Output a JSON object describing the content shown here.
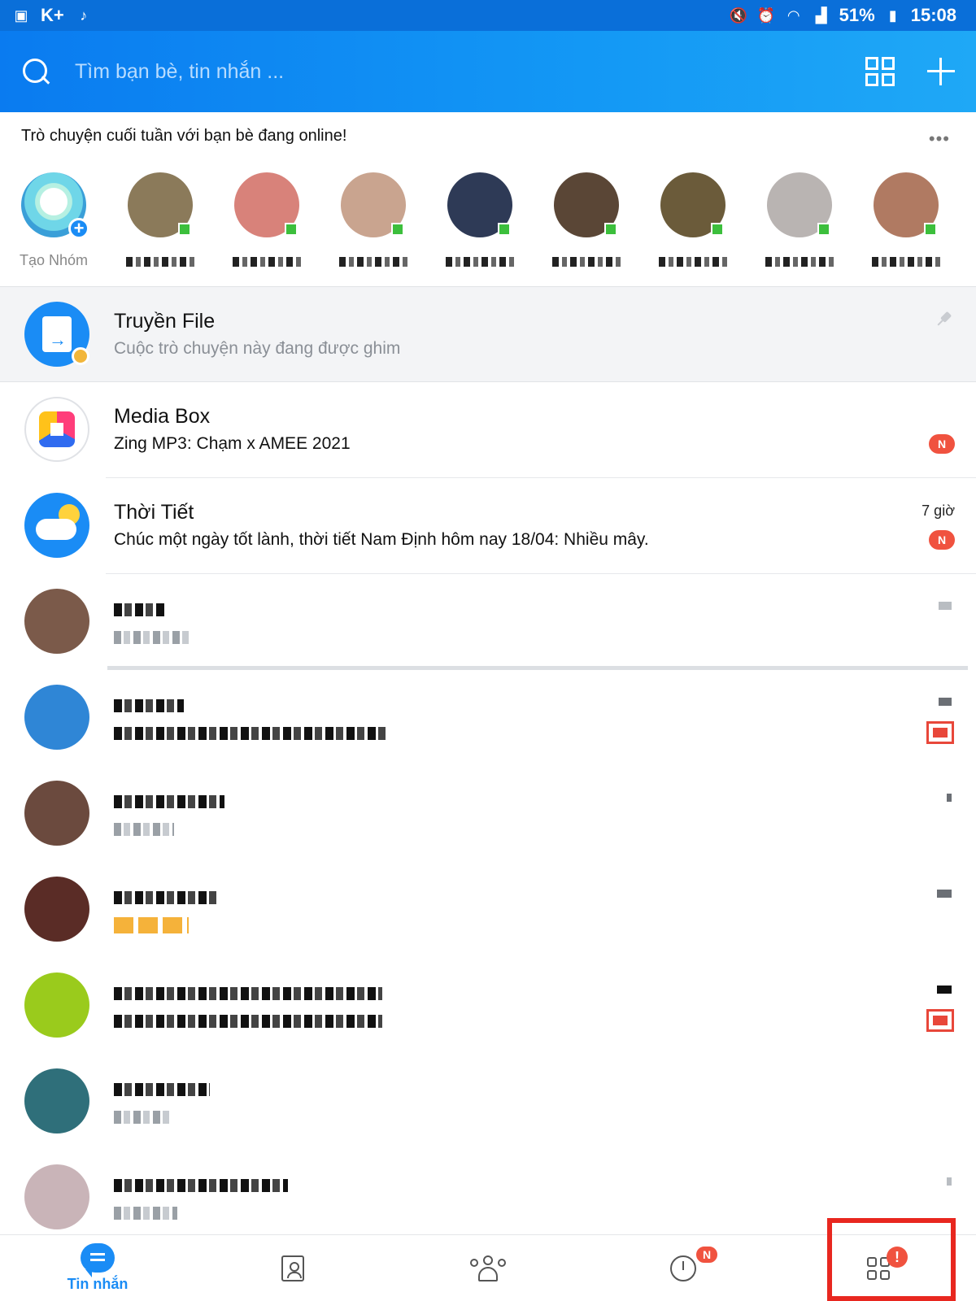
{
  "status_bar": {
    "icons_left": [
      "image-icon",
      "kplus-icon",
      "tiktok-icon"
    ],
    "kplus_label": "K+",
    "battery": "51%",
    "time": "15:08"
  },
  "header": {
    "search_placeholder": "Tìm bạn bè, tin nhắn ..."
  },
  "online": {
    "title": "Trò chuyện cuối tuần với bạn bè đang online!",
    "create_group_label": "Tạo Nhóm",
    "friends": [
      {
        "color": "#8b7a5a"
      },
      {
        "color": "#d8827a"
      },
      {
        "color": "#c9a48f"
      },
      {
        "color": "#2e3a56"
      },
      {
        "color": "#5a4636"
      },
      {
        "color": "#6b5b3a"
      },
      {
        "color": "#b9b4b2"
      },
      {
        "color": "#b07a62"
      }
    ]
  },
  "conversations": {
    "pinned": {
      "name": "Truyền File",
      "message": "Cuộc trò chuyện này đang được ghim"
    },
    "media_box": {
      "name": "Media Box",
      "message": "Zing MP3: Chạm x AMEE 2021",
      "badge": "N"
    },
    "weather": {
      "name": "Thời Tiết",
      "message": "Chúc một ngày tốt lành, thời tiết Nam Định hôm nay 18/04: Nhiều mây.",
      "time": "7 giờ",
      "badge": "N"
    }
  },
  "bottom_nav": {
    "messages_label": "Tin nhắn",
    "timeline_badge": "N",
    "apps_badge": "!"
  },
  "colors": {
    "brand": "#0a7bf0",
    "badge": "#f0523f",
    "highlight": "#e8271f"
  }
}
